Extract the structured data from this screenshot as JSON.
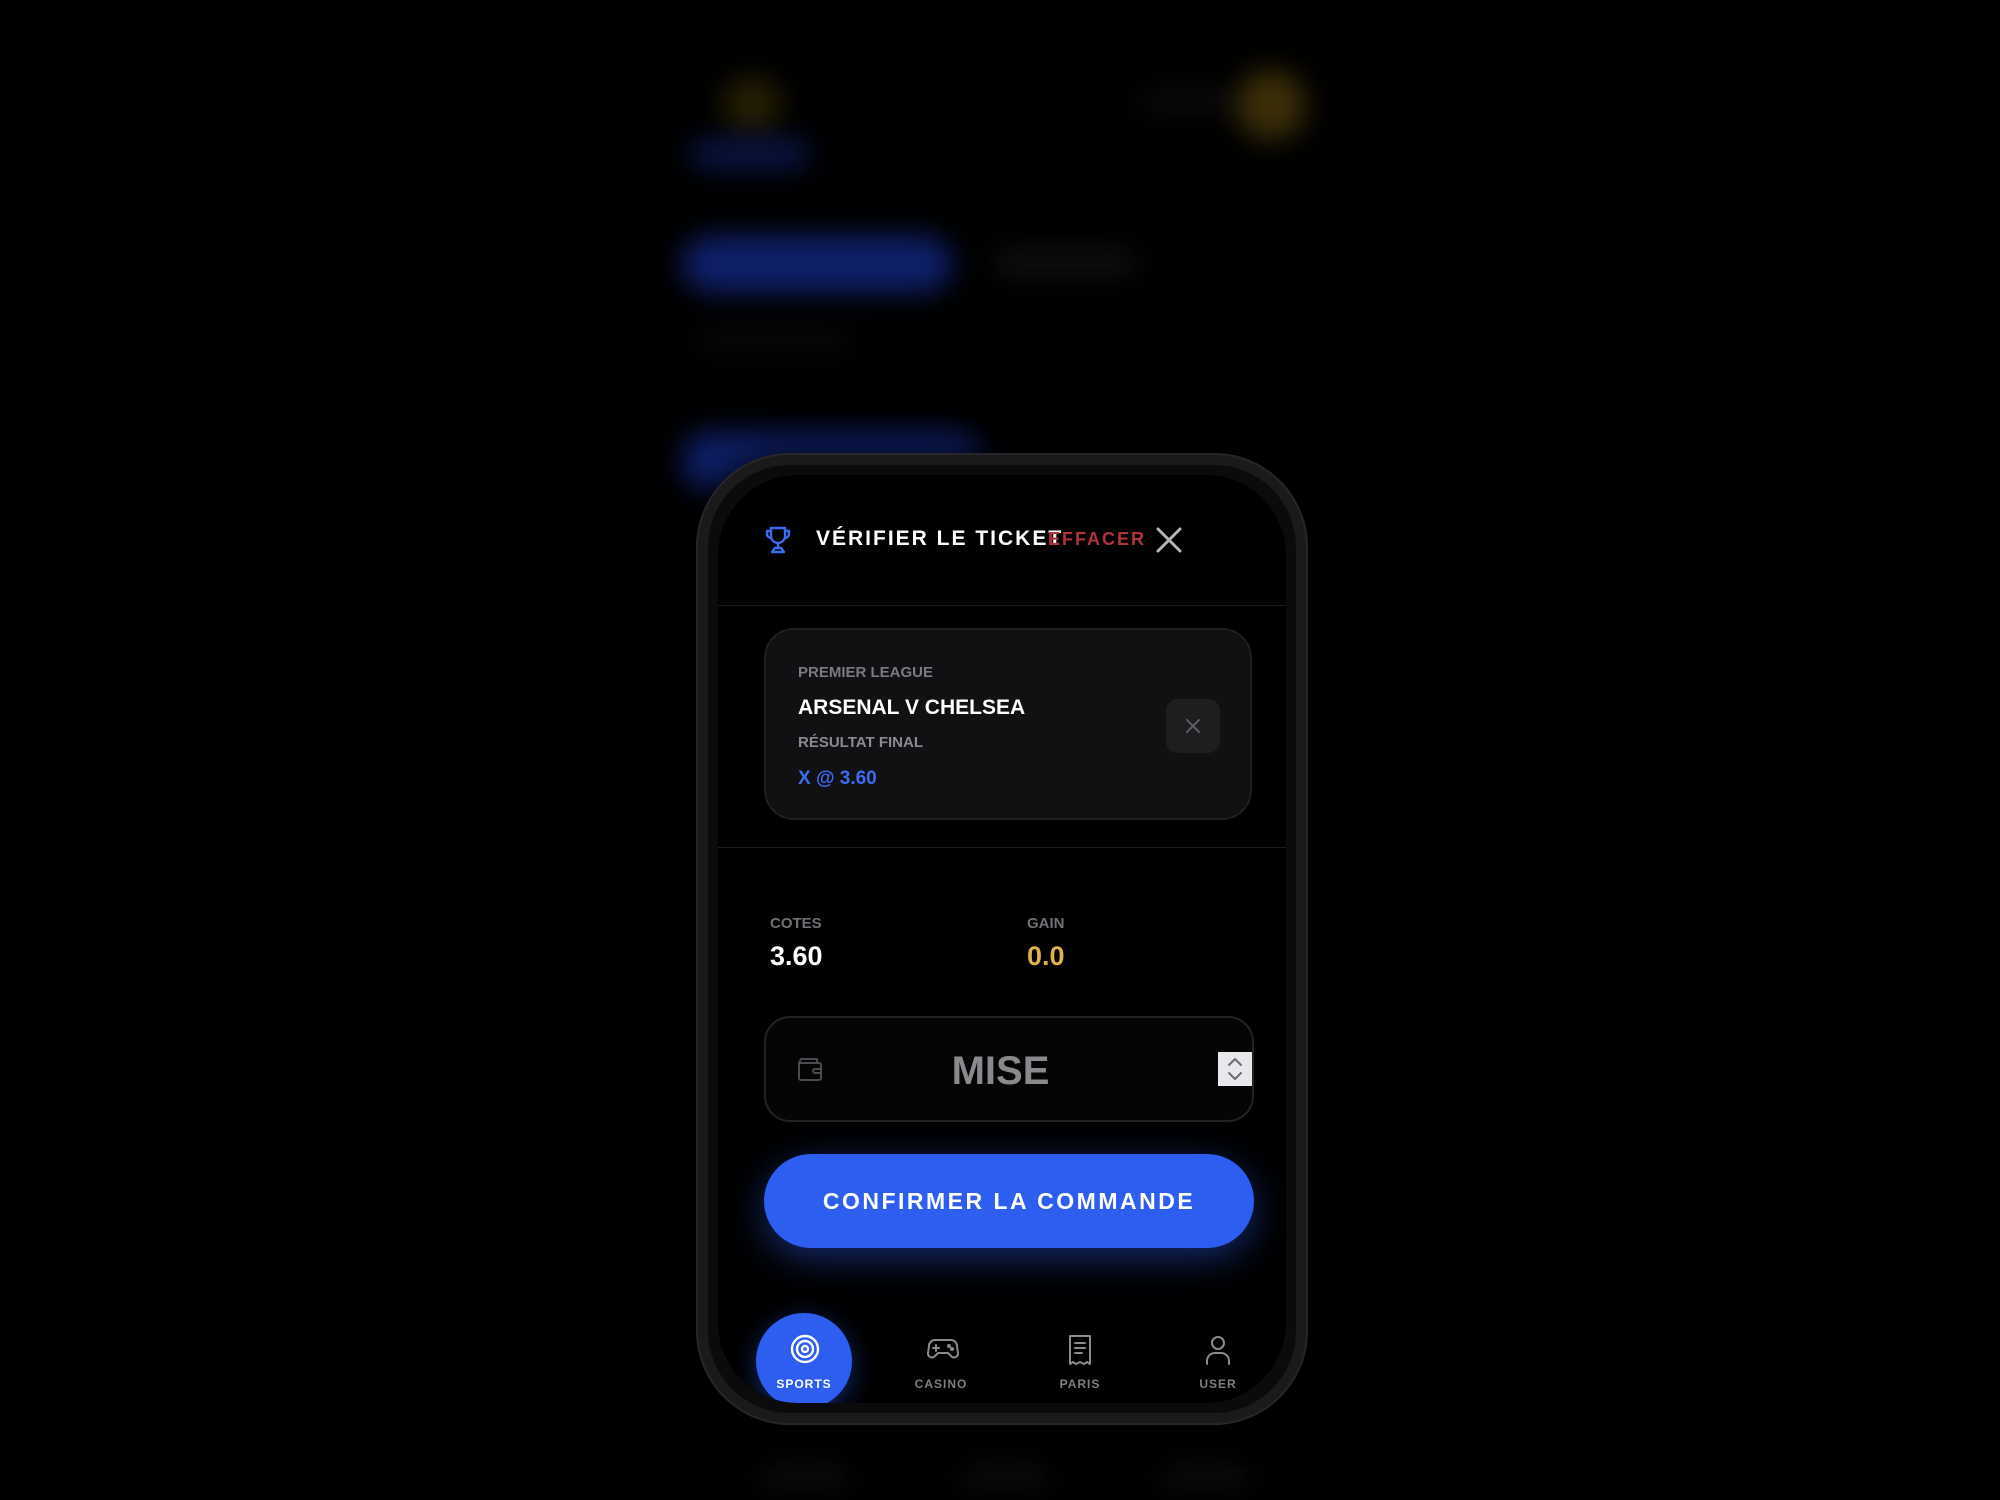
{
  "header": {
    "title": "VÉRIFIER LE TICKET",
    "clear_label": "EFFACER"
  },
  "bet": {
    "league": "PREMIER LEAGUE",
    "match": "ARSENAL V CHELSEA",
    "market": "RÉSULTAT FINAL",
    "selection": "X @ 3.60"
  },
  "summary": {
    "odds_label": "COTES",
    "odds_value": "3.60",
    "gain_label": "GAIN",
    "gain_value": "0.0"
  },
  "stake": {
    "placeholder": "MISE",
    "value": ""
  },
  "confirm_label": "CONFIRMER LA COMMANDE",
  "nav": [
    {
      "label": "SPORTS",
      "icon": "target-icon",
      "active": true
    },
    {
      "label": "CASINO",
      "icon": "gamepad-icon",
      "active": false
    },
    {
      "label": "PARIS",
      "icon": "receipt-icon",
      "active": false
    },
    {
      "label": "USER",
      "icon": "user-icon",
      "active": false
    }
  ],
  "colors": {
    "accent": "#2d5ef0",
    "danger": "#b0343a",
    "gain": "#e0b24c",
    "background": "#000000"
  }
}
